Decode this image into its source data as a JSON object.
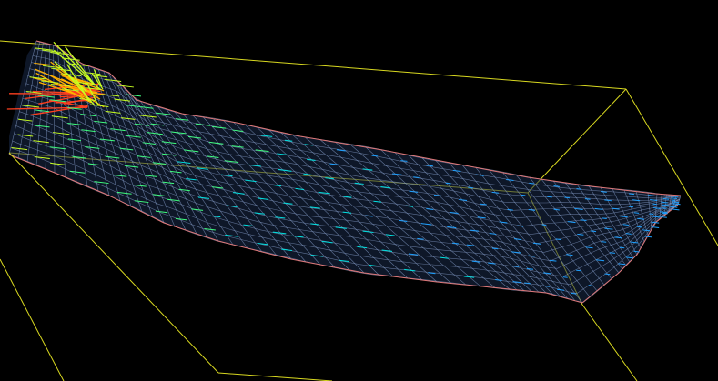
{
  "viewport": {
    "background": "#000000",
    "bounding_box_color": "#d8d820",
    "mesh_edge_color": "#e07878",
    "mesh_line_color": "#88a0cc",
    "vector_colors_low_to_high": [
      "#1ea0ff",
      "#00e0e0",
      "#40ff80",
      "#c8ff20",
      "#ffb000",
      "#ff4020"
    ]
  }
}
